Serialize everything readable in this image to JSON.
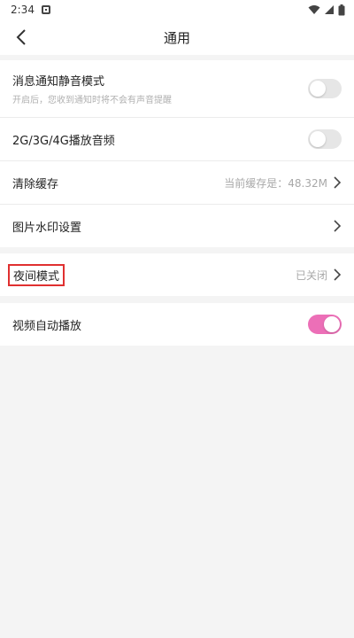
{
  "status_bar": {
    "time": "2:34"
  },
  "header": {
    "title": "通用"
  },
  "settings": {
    "silent_mode": {
      "label": "消息通知静音模式",
      "sub": "开启后，您收到通知时将不会有声音提醒",
      "enabled": false
    },
    "cellular_audio": {
      "label": "2G/3G/4G播放音频",
      "enabled": false
    },
    "clear_cache": {
      "label": "清除缓存",
      "value": "当前缓存是：48.32M"
    },
    "watermark": {
      "label": "图片水印设置"
    },
    "night_mode": {
      "label": "夜间模式",
      "value": "已关闭"
    },
    "autoplay": {
      "label": "视频自动播放",
      "enabled": true
    }
  },
  "colors": {
    "accent": "#ec6fb7",
    "highlight_border": "#e03030",
    "background": "#f4f4f4"
  }
}
